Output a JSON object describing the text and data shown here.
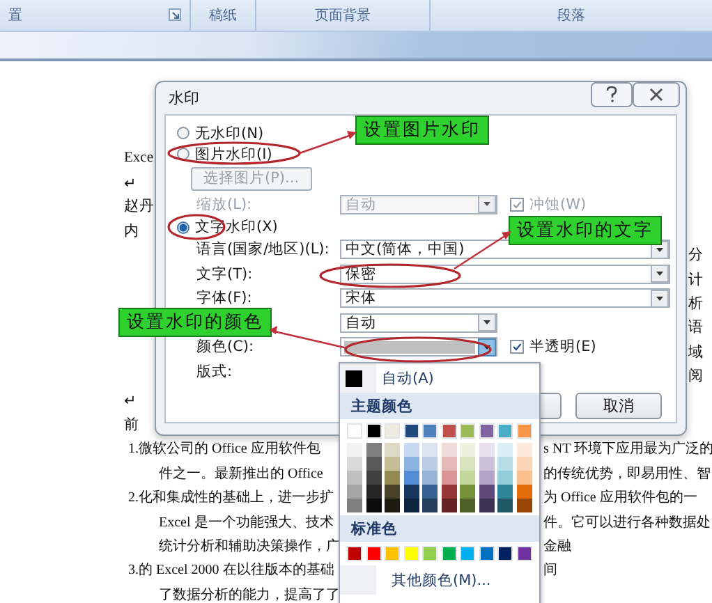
{
  "ribbon": {
    "groups": [
      {
        "label": "置",
        "launcher": true
      },
      {
        "label": "稿纸",
        "launcher": false
      },
      {
        "label": "页面背景",
        "launcher": false
      },
      {
        "label": "段落",
        "launcher": false
      }
    ]
  },
  "document": {
    "lines": [
      {
        "kind": "edge",
        "left": "Exce"
      },
      {
        "kind": "edge",
        "left": "↵"
      },
      {
        "kind": "edge",
        "left": "赵丹"
      },
      {
        "kind": "edge",
        "left": "内"
      },
      {
        "kind": "edge",
        "right": "分"
      },
      {
        "kind": "edge",
        "right": "计"
      },
      {
        "kind": "edge",
        "right": "析"
      },
      {
        "kind": "edge",
        "right": "语"
      },
      {
        "kind": "edge",
        "right": "域"
      },
      {
        "kind": "edge",
        "right": "阅"
      },
      {
        "kind": "edge",
        "left": "↵"
      },
      {
        "kind": "edge",
        "left": "前"
      },
      {
        "kind": "body",
        "continuation": false,
        "left": "1.微软公司的 Office 应用软件包",
        "right": "s NT 环境下应用最为广泛的"
      },
      {
        "kind": "body",
        "continuation": true,
        "left": "件之一。最新推出的 Office",
        "right": "的传统优势，即易用性、智"
      },
      {
        "kind": "body",
        "continuation": false,
        "left": "2.化和集成性的基础上，进一步扩",
        "right": "为 Office 应用软件包的一"
      },
      {
        "kind": "body",
        "continuation": true,
        "left": "Excel 是一个功能强大、技术",
        "right": "件。它可以进行各种数据处"
      },
      {
        "kind": "body",
        "continuation": true,
        "left": "统计分析和辅助决策操作，广",
        "right": "金融"
      },
      {
        "kind": "body",
        "continuation": false,
        "left": "3.的 Excel 2000 在以往版本的基础",
        "right": "间"
      },
      {
        "kind": "body",
        "continuation": true,
        "left": "了数据分析的能力，提高了了"
      }
    ]
  },
  "dialog": {
    "title": "水印",
    "no_watermark": {
      "label": "无水印(N)",
      "selected": false
    },
    "picture_watermark": {
      "label": "图片水印(I)",
      "selected": false,
      "select_button": {
        "label": "选择图片(P)...",
        "disabled": true
      },
      "scale": {
        "label": "缩放(L):",
        "value": "自动",
        "disabled": true
      },
      "washout": {
        "label": "冲蚀(W)",
        "checked": true,
        "disabled": true
      }
    },
    "text_watermark": {
      "label": "文字水印(X)",
      "selected": true,
      "fields": [
        {
          "kind": "wide",
          "label": "语言(国家/地区)(L):",
          "value": "中文(简体，中国)"
        },
        {
          "kind": "wide",
          "label": "文字(T):",
          "value": "保密"
        },
        {
          "kind": "wide",
          "label": "字体(F):",
          "value": "宋体"
        },
        {
          "kind": "narrow",
          "value": "自动"
        },
        {
          "kind": "color",
          "label": "颜色(C):"
        },
        {
          "kind": "layout",
          "label": "版式:"
        }
      ],
      "semitransparent": {
        "label": "半透明(E)",
        "checked": true
      }
    },
    "buttons": [
      {
        "label": "取消"
      }
    ]
  },
  "color_menu": {
    "auto": {
      "label": "自动(A)",
      "color": "#000000"
    },
    "theme_title": "主题颜色",
    "theme_colors": [
      {
        "color": "#ffffff",
        "shades": [
          {
            "color": "#f2f2f2"
          },
          {
            "color": "#d9d9d9"
          },
          {
            "color": "#bfbfbf"
          },
          {
            "color": "#a6a6a6"
          },
          {
            "color": "#808080"
          }
        ]
      },
      {
        "color": "#000000",
        "shades": [
          {
            "color": "#7f7f7f"
          },
          {
            "color": "#595959"
          },
          {
            "color": "#404040"
          },
          {
            "color": "#262626"
          },
          {
            "color": "#0d0d0d"
          }
        ]
      },
      {
        "color": "#eeece1",
        "shades": [
          {
            "color": "#ddd9c3"
          },
          {
            "color": "#c4bd97"
          },
          {
            "color": "#938953"
          },
          {
            "color": "#494429"
          },
          {
            "color": "#1d1b10"
          }
        ]
      },
      {
        "color": "#1f497d",
        "shades": [
          {
            "color": "#c6d9f0"
          },
          {
            "color": "#8db3e2"
          },
          {
            "color": "#548dd4"
          },
          {
            "color": "#17365d"
          },
          {
            "color": "#0f243e"
          }
        ]
      },
      {
        "color": "#4f81bd",
        "shades": [
          {
            "color": "#dbe5f1"
          },
          {
            "color": "#b8cce4"
          },
          {
            "color": "#95b3d7"
          },
          {
            "color": "#366092"
          },
          {
            "color": "#244061"
          }
        ]
      },
      {
        "color": "#c0504d",
        "shades": [
          {
            "color": "#f2dcdb"
          },
          {
            "color": "#e5b9b7"
          },
          {
            "color": "#d99694"
          },
          {
            "color": "#953734"
          },
          {
            "color": "#632423"
          }
        ]
      },
      {
        "color": "#9bbb59",
        "shades": [
          {
            "color": "#ebf1dd"
          },
          {
            "color": "#d7e3bc"
          },
          {
            "color": "#c3d69b"
          },
          {
            "color": "#76923c"
          },
          {
            "color": "#4f6128"
          }
        ]
      },
      {
        "color": "#8064a2",
        "shades": [
          {
            "color": "#e5e0ec"
          },
          {
            "color": "#ccc1d9"
          },
          {
            "color": "#b2a2c7"
          },
          {
            "color": "#5f497a"
          },
          {
            "color": "#3f3151"
          }
        ]
      },
      {
        "color": "#4bacc6",
        "shades": [
          {
            "color": "#dbeef3"
          },
          {
            "color": "#b7dde8"
          },
          {
            "color": "#92cddc"
          },
          {
            "color": "#31859b"
          },
          {
            "color": "#205867"
          }
        ]
      },
      {
        "color": "#f79646",
        "shades": [
          {
            "color": "#fdeada"
          },
          {
            "color": "#fbd5b5"
          },
          {
            "color": "#fac08f"
          },
          {
            "color": "#e36c09"
          },
          {
            "color": "#974806"
          }
        ]
      }
    ],
    "standard_title": "标准色",
    "standard_colors": [
      {
        "color": "#c00000"
      },
      {
        "color": "#ff0000"
      },
      {
        "color": "#ffc000"
      },
      {
        "color": "#ffff00"
      },
      {
        "color": "#92d050"
      },
      {
        "color": "#00b050"
      },
      {
        "color": "#00b0f0"
      },
      {
        "color": "#0070c0"
      },
      {
        "color": "#002060"
      },
      {
        "color": "#7030a0"
      }
    ],
    "more": "其他颜色(M)..."
  },
  "annotations": [
    {
      "text": "设置图片水印"
    },
    {
      "text": "设置水印的文字"
    },
    {
      "text": "设置水印的颜色"
    }
  ]
}
